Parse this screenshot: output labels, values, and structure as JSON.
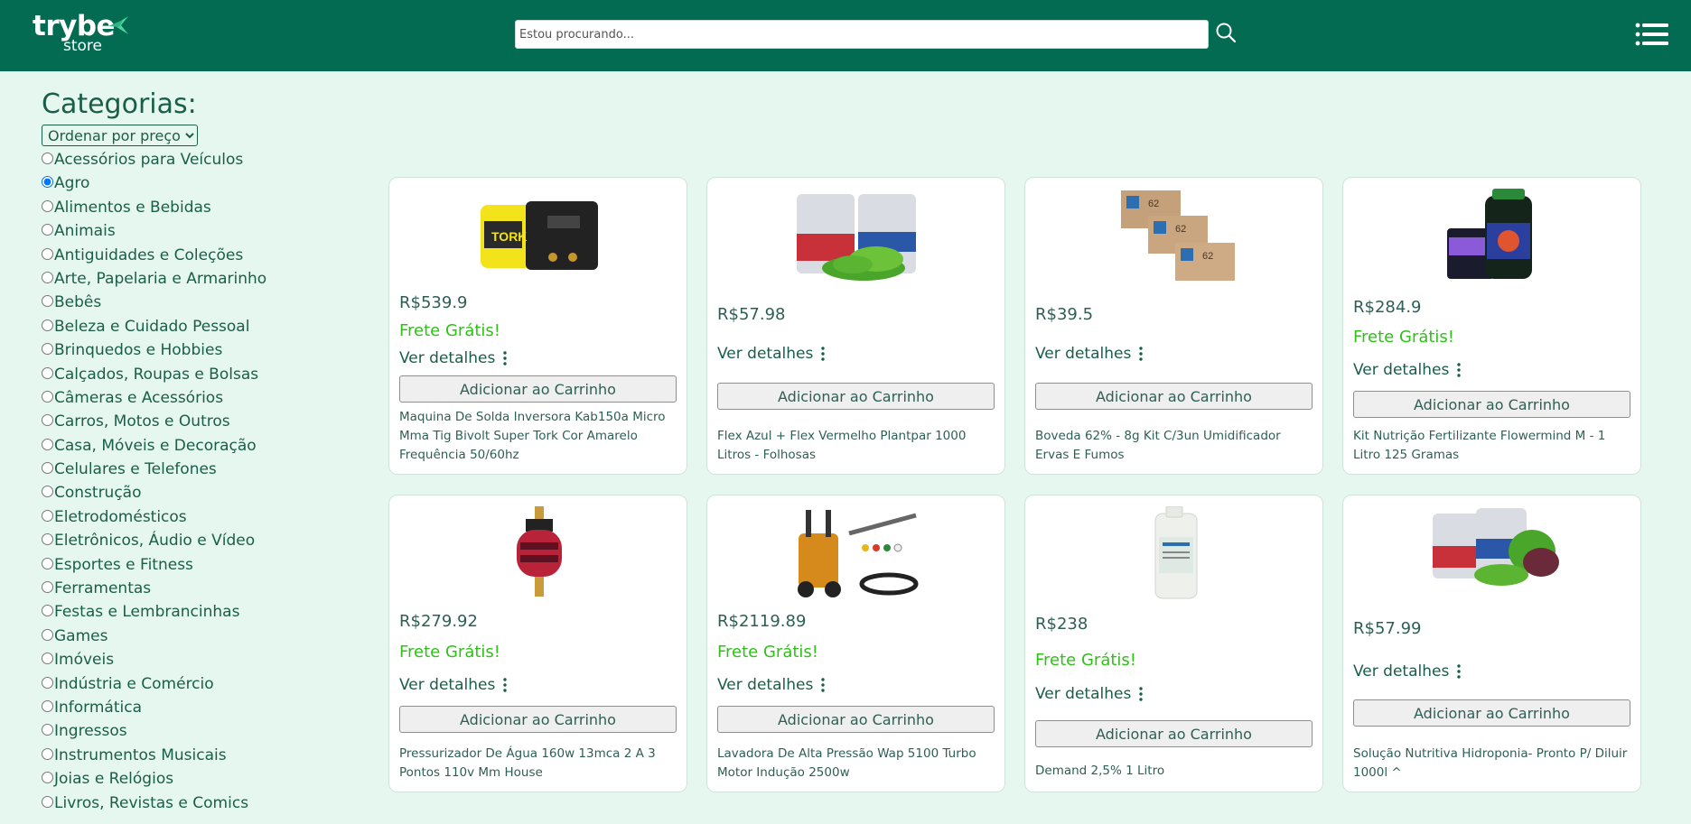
{
  "header": {
    "logo_main": "trybe",
    "logo_sub": "store",
    "search_placeholder": "Estou procurando..."
  },
  "sidebar": {
    "title": "Categorias:",
    "sort_selected": "Ordenar por preço",
    "selected_category": "Agro",
    "categories": [
      "Acessórios para Veículos",
      "Agro",
      "Alimentos e Bebidas",
      "Animais",
      "Antiguidades e Coleções",
      "Arte, Papelaria e Armarinho",
      "Bebês",
      "Beleza e Cuidado Pessoal",
      "Brinquedos e Hobbies",
      "Calçados, Roupas e Bolsas",
      "Câmeras e Acessórios",
      "Carros, Motos e Outros",
      "Casa, Móveis e Decoração",
      "Celulares e Telefones",
      "Construção",
      "Eletrodomésticos",
      "Eletrônicos, Áudio e Vídeo",
      "Esportes e Fitness",
      "Ferramentas",
      "Festas e Lembrancinhas",
      "Games",
      "Imóveis",
      "Indústria e Comércio",
      "Informática",
      "Ingressos",
      "Instrumentos Musicais",
      "Joias e Relógios",
      "Livros, Revistas e Comics"
    ]
  },
  "labels": {
    "details": "Ver detalhes",
    "add_to_cart": "Adicionar ao Carrinho",
    "free_shipping": "Frete Grátis!"
  },
  "products": [
    {
      "price": "R$539.9",
      "free_shipping": true,
      "title": "Maquina De Solda Inversora Kab150a Micro Mma Tig Bivolt Super Tork Cor Amarelo Frequência 50/60hz",
      "image": "welding-machine"
    },
    {
      "price": "R$57.98",
      "free_shipping": false,
      "title": "Flex Azul + Flex Vermelho Plantpar 1000 Litros - Folhosas",
      "image": "fertilizer-bags"
    },
    {
      "price": "R$39.5",
      "free_shipping": false,
      "title": "Boveda 62% - 8g Kit C/3un Umidificador Ervas E Fumos",
      "image": "humidity-packs"
    },
    {
      "price": "R$284.9",
      "free_shipping": true,
      "title": "Kit Nutrição Fertilizante Flowermind M - 1 Litro 125 Gramas",
      "image": "fertilizer-kit"
    },
    {
      "price": "R$279.92",
      "free_shipping": true,
      "title": "Pressurizador De Água 160w 13mca 2 A 3 Pontos 110v Mm House",
      "image": "water-pump"
    },
    {
      "price": "R$2119.89",
      "free_shipping": true,
      "title": "Lavadora De Alta Pressão Wap 5100 Turbo Motor Indução 2500w",
      "image": "pressure-washer"
    },
    {
      "price": "R$238",
      "free_shipping": true,
      "title": "Demand 2,5% 1 Litro",
      "image": "chemical-bottle"
    },
    {
      "price": "R$57.99",
      "free_shipping": false,
      "title": "Solução Nutritiva Hidroponia- Pronto P/ Diluir 1000l ^",
      "image": "hydroponic-bags"
    }
  ]
}
